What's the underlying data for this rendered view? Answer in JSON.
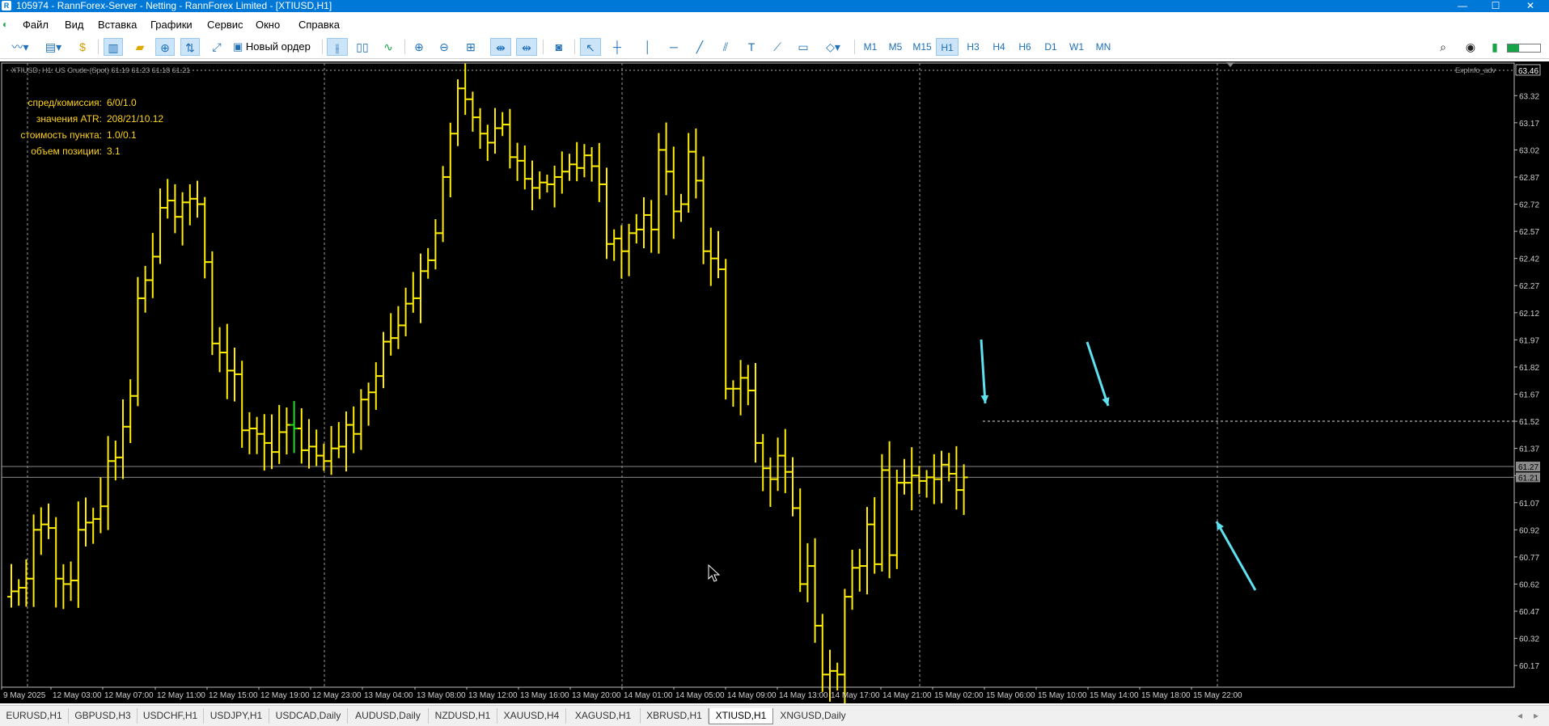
{
  "window": {
    "title": "105974 - RannForex-Server - Netting - RannForex Limited - [XTIUSD,H1]",
    "minimize": "—",
    "maximize": "☐",
    "close": "✕"
  },
  "menu": [
    "Файл",
    "Вид",
    "Вставка",
    "Графики",
    "Сервис",
    "Окно",
    "Справка"
  ],
  "toolbar": {
    "new_order_label": "Новый ордер",
    "timeframes": [
      "M1",
      "M5",
      "M15",
      "H1",
      "H3",
      "H4",
      "H6",
      "D1",
      "W1",
      "MN"
    ],
    "active_timeframe": "H1"
  },
  "chart_header": {
    "symbol_line": "XTIUSD, H1: US Crude (Spot) 61.19 61.23 61.18 61.21",
    "expinfo": "ExpInfo_adv"
  },
  "info_panel": [
    {
      "label": "спред/комиссия:",
      "value": "6/0/1.0"
    },
    {
      "label": "значения ATR:",
      "value": "208/21/10.12"
    },
    {
      "label": "стоимость пункта:",
      "value": "1.0/0.1"
    },
    {
      "label": "объем позиции:",
      "value": "3.1"
    }
  ],
  "chart_data": {
    "type": "ohlc",
    "symbol": "XTIUSD",
    "timeframe": "H1",
    "bar_color": "#ffee00",
    "background": "#000000",
    "ylim": [
      60.05,
      63.5
    ],
    "y_ticks": [
      "63.32",
      "63.17",
      "63.02",
      "62.87",
      "62.72",
      "62.57",
      "62.42",
      "62.27",
      "62.12",
      "61.97",
      "61.82",
      "61.67",
      "61.52",
      "61.37",
      "61.22",
      "61.07",
      "60.92",
      "60.77",
      "60.62",
      "60.47",
      "60.32",
      "60.17"
    ],
    "top_label": "63.46",
    "current_price_labels": [
      "61.27",
      "61.21"
    ],
    "resistance_level": 61.52,
    "x_labels": [
      "9 May 2025",
      "12 May 03:00",
      "12 May 07:00",
      "12 May 11:00",
      "12 May 15:00",
      "12 May 19:00",
      "12 May 23:00",
      "13 May 04:00",
      "13 May 08:00",
      "13 May 12:00",
      "13 May 16:00",
      "13 May 20:00",
      "14 May 01:00",
      "14 May 05:00",
      "14 May 09:00",
      "14 May 13:00",
      "14 May 17:00",
      "14 May 21:00",
      "15 May 02:00",
      "15 May 06:00",
      "15 May 10:00",
      "15 May 14:00",
      "15 May 18:00",
      "15 May 22:00"
    ],
    "closes": [
      60.58,
      60.6,
      60.65,
      60.92,
      60.95,
      60.93,
      60.65,
      60.62,
      60.64,
      60.92,
      60.96,
      60.98,
      61.05,
      61.3,
      61.32,
      61.49,
      61.66,
      62.2,
      62.3,
      62.43,
      62.7,
      62.74,
      62.65,
      62.73,
      62.75,
      62.72,
      62.4,
      61.95,
      61.9,
      61.8,
      61.78,
      61.47,
      61.48,
      61.45,
      61.4,
      61.35,
      61.46,
      61.5,
      61.48,
      61.36,
      61.38,
      61.33,
      61.3,
      61.37,
      61.38,
      61.5,
      61.45,
      61.64,
      61.68,
      61.77,
      61.96,
      61.98,
      62.05,
      62.17,
      62.2,
      62.35,
      62.41,
      62.56,
      62.87,
      63.11,
      63.36,
      63.3,
      63.2,
      63.11,
      63.06,
      63.14,
      63.16,
      62.98,
      62.96,
      62.86,
      62.81,
      62.84,
      62.83,
      62.87,
      62.9,
      62.94,
      62.92,
      62.99,
      62.93,
      62.83,
      62.5,
      62.53,
      62.46,
      62.56,
      62.58,
      62.66,
      62.58,
      63.02,
      62.9,
      62.68,
      62.72,
      63.01,
      62.85,
      62.46,
      62.42,
      62.36,
      61.7,
      61.7,
      61.76,
      61.69,
      61.4,
      61.26,
      61.2,
      61.33,
      61.24,
      61.04,
      60.62,
      60.72,
      60.39,
      60.12,
      60.14,
      60.12,
      60.55,
      60.71,
      60.72,
      60.95,
      60.73,
      61.25,
      60.78,
      61.18,
      61.18,
      61.22,
      61.19,
      61.21,
      61.2,
      61.28,
      61.23,
      61.14,
      61.21
    ]
  },
  "tabs": [
    "EURUSD,H1",
    "GBPUSD,H3",
    "USDCHF,H1",
    "USDJPY,H1",
    "USDCAD,Daily",
    "AUDUSD,Daily",
    "NZDUSD,H1",
    "XAUUSD,H4",
    "XAGUSD,H1",
    "XBRUSD,H1",
    "XTIUSD,H1",
    "XNGUSD,Daily"
  ],
  "active_tab": "XTIUSD,H1"
}
